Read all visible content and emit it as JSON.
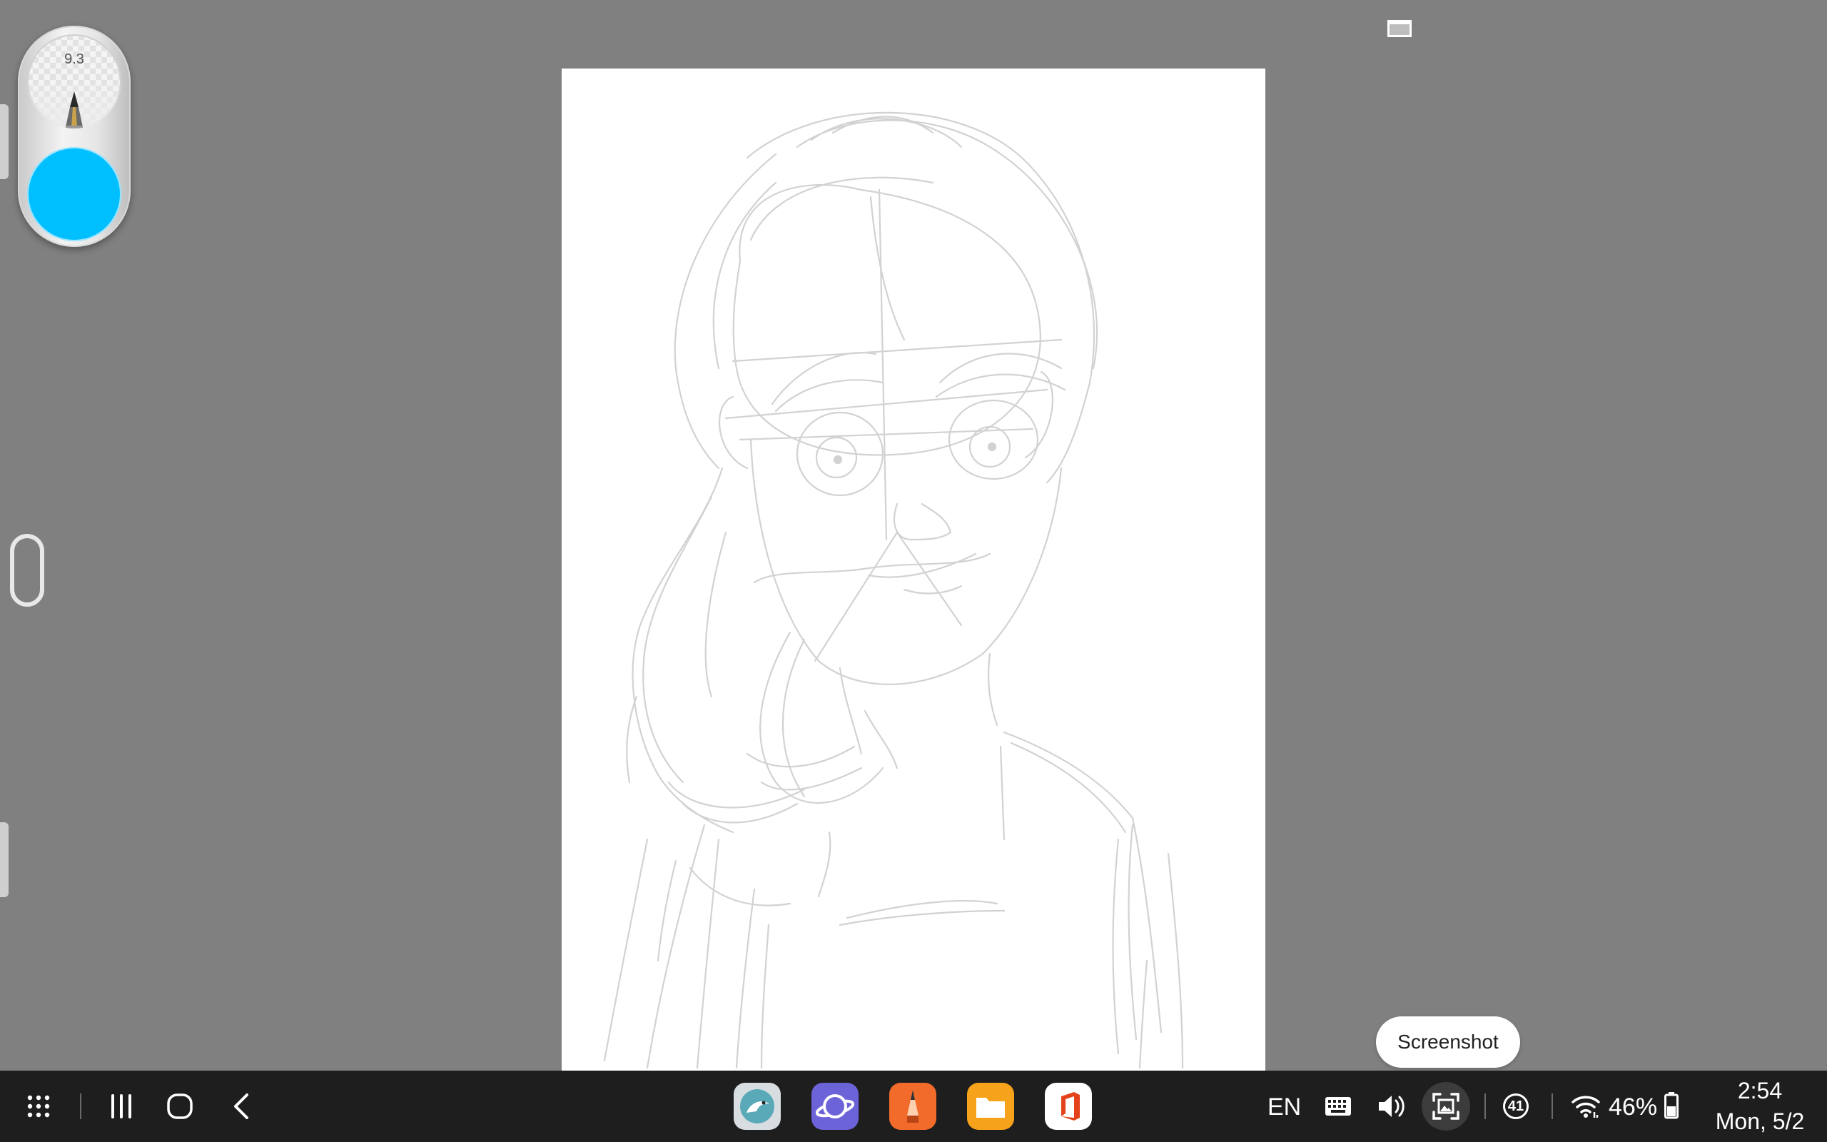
{
  "brush": {
    "size": "9.3",
    "color": "#00bfff"
  },
  "tooltip": {
    "label": "Screenshot"
  },
  "taskbar": {
    "apps": [
      {
        "name": "kiwi-browser",
        "color": "#d7dde0"
      },
      {
        "name": "samsung-internet",
        "color": "#6c63d8"
      },
      {
        "name": "sketchbook",
        "color": "#f26b2a"
      },
      {
        "name": "my-files",
        "color": "#f7a21b"
      },
      {
        "name": "microsoft-office",
        "color": "#ffffff"
      }
    ],
    "language": "EN",
    "notifications": "41",
    "battery": "46%",
    "time": "2:54",
    "date": "Mon, 5/2"
  }
}
